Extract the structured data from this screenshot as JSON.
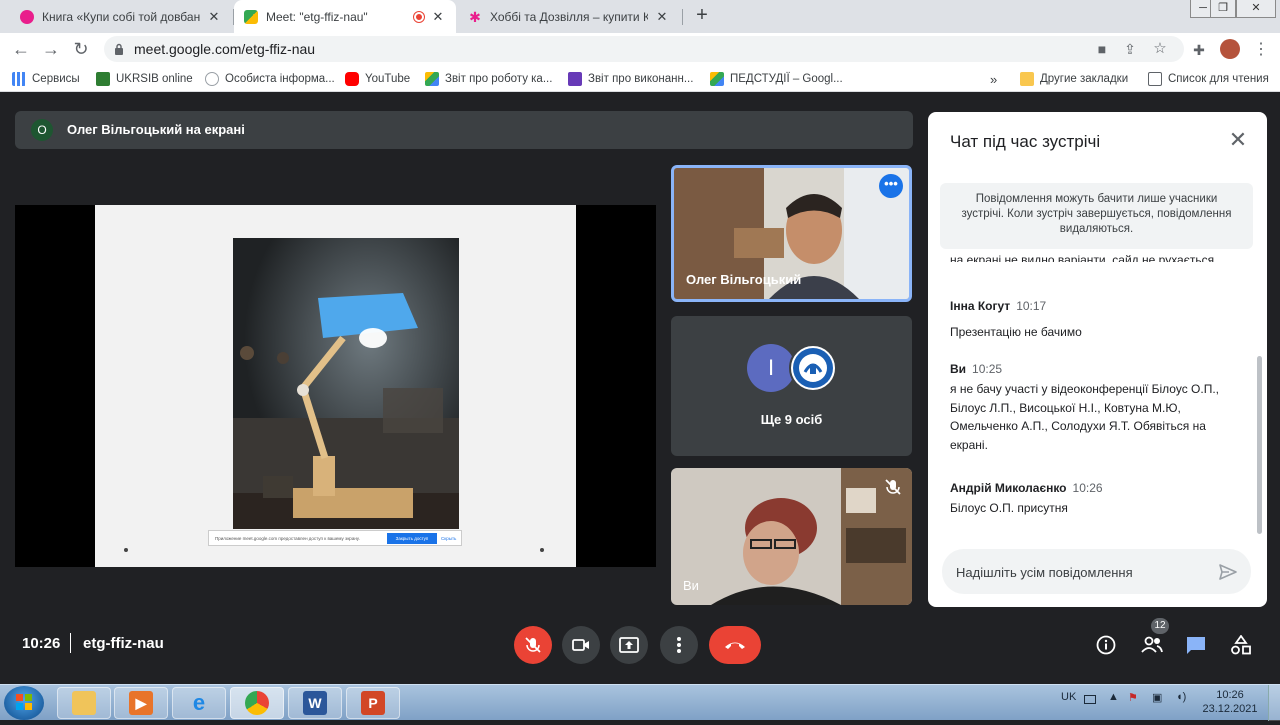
{
  "browser": {
    "tabs": [
      {
        "title": "Книга «Купи собі той довбаний",
        "active": false
      },
      {
        "title": "Meet: \"etg-ffiz-nau\"",
        "active": true
      },
      {
        "title": "Хоббі та Дозвілля – купити Кни",
        "active": false
      }
    ],
    "new_tab": "+",
    "url": "meet.google.com/etg-ffiz-nau",
    "bookmarks": [
      {
        "label": "Сервисы"
      },
      {
        "label": "UKRSIB online"
      },
      {
        "label": "Особиста інформа..."
      },
      {
        "label": "YouTube"
      },
      {
        "label": "Звіт про роботу ка..."
      },
      {
        "label": "Звіт про виконанн..."
      },
      {
        "label": "ПЕДСТУДІЇ – Googl..."
      }
    ],
    "bookmarks_more": "»",
    "other_bookmarks": "Другие закладки",
    "reading_list": "Список для чтения"
  },
  "meet": {
    "presenter_avatar_letter": "О",
    "presenting_text": "Олег Вільгоцький на екрані",
    "share_notice_text": "Приложение meet.google.com предоставлен доступ к вашему экрану.",
    "share_notice_button": "Закрыть доступ",
    "share_notice_hide": "Скрыть",
    "tiles": [
      {
        "name": "Олег Вільгоцький"
      },
      {
        "avatar_letter": "I",
        "label": "Ще 9 осіб"
      },
      {
        "name": "Ви"
      }
    ],
    "time": "10:26",
    "meeting_code": "etg-ffiz-nau",
    "participants_count": "12"
  },
  "chat": {
    "title": "Чат під час зустрічі",
    "notice": "Повідомлення можуть бачити лише учасники зустрічі. Коли зустріч завершується, повідомлення видаляються.",
    "clipped_text": "на екрані не видно варіанти, сайд не рухається",
    "messages": [
      {
        "sender": "Інна Когут",
        "time": "10:17",
        "text": "Презентацію не бачимо"
      },
      {
        "sender": "Ви",
        "time": "10:25",
        "text": "я не бачу участі у відеоконференції Білоус О.П., Білоус Л.П., Висоцької Н.І., Ковтуна М.Ю, Омельченко А.П., Солодухи Я.Т. Обявіться на екрані."
      },
      {
        "sender": "Андрій Миколаєнко",
        "time": "10:26",
        "text": "Білоус О.П. присутня"
      }
    ],
    "input_placeholder": "Надішліть усім повідомлення"
  },
  "taskbar": {
    "lang": "UK",
    "time": "10:26",
    "date": "23.12.2021"
  },
  "colors": {
    "meet_bg": "#202124",
    "accent_blue": "#1a73e8",
    "danger_red": "#ea4335"
  }
}
